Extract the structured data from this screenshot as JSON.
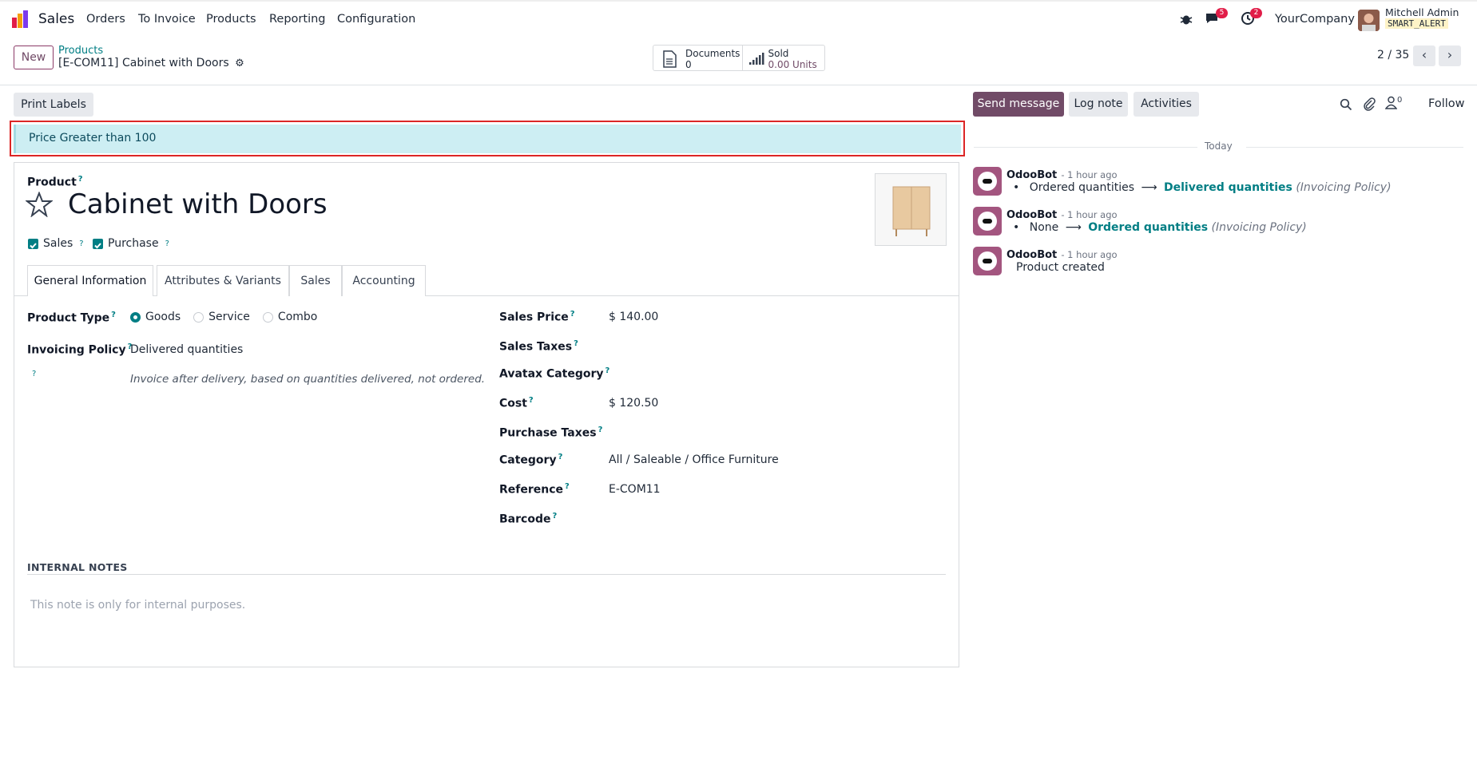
{
  "app": {
    "name": "Sales"
  },
  "menu": [
    "Orders",
    "To Invoice",
    "Products",
    "Reporting",
    "Configuration"
  ],
  "systray": {
    "messages_count": "5",
    "activities_count": "2",
    "company": "YourCompany",
    "user_name": "Mitchell Admin",
    "user_db": "SMART_ALERT"
  },
  "control": {
    "new_label": "New",
    "breadcrumb_parent": "Products",
    "breadcrumb_current": "[E-COM11] Cabinet with Doors",
    "pager": "2 / 35",
    "smart_buttons": [
      {
        "label": "Documents",
        "value": "0"
      },
      {
        "label": "Sold",
        "value": "0.00 Units"
      }
    ]
  },
  "form": {
    "print_labels": "Print Labels",
    "alert": "Price Greater than 100",
    "product_label": "Product",
    "product_name": "Cabinet with Doors",
    "sales_cb": "Sales",
    "purchase_cb": "Purchase",
    "tabs": [
      "General Information",
      "Attributes & Variants",
      "Sales",
      "Accounting"
    ],
    "product_type_label": "Product Type",
    "product_type_options": [
      "Goods",
      "Service",
      "Combo"
    ],
    "invoicing_policy_label": "Invoicing Policy",
    "invoicing_policy_value": "Delivered quantities",
    "invoicing_help": "Invoice after delivery, based on quantities delivered, not ordered.",
    "right_fields": [
      {
        "label": "Sales Price",
        "value": "$ 140.00"
      },
      {
        "label": "Sales Taxes",
        "value": ""
      },
      {
        "label": "Avatax Category",
        "value": ""
      },
      {
        "label": "Cost",
        "value": "$ 120.50"
      },
      {
        "label": "Purchase Taxes",
        "value": ""
      },
      {
        "label": "Category",
        "value": "All / Saleable / Office Furniture"
      },
      {
        "label": "Reference",
        "value": "E-COM11"
      },
      {
        "label": "Barcode",
        "value": ""
      }
    ],
    "internal_notes_header": "INTERNAL NOTES",
    "internal_notes_placeholder": "This note is only for internal purposes."
  },
  "chatter": {
    "send_message": "Send message",
    "log_note": "Log note",
    "activities": "Activities",
    "follow": "Follow",
    "followers_count": "0",
    "today": "Today",
    "messages": [
      {
        "author": "OdooBot",
        "time": "- 1 hour ago",
        "old": "Ordered quantities",
        "new": "Delivered quantities",
        "field": "(Invoicing Policy)"
      },
      {
        "author": "OdooBot",
        "time": "- 1 hour ago",
        "old": "None",
        "new": "Ordered quantities",
        "field": "(Invoicing Policy)"
      },
      {
        "author": "OdooBot",
        "time": "- 1 hour ago",
        "body": "Product created"
      }
    ]
  },
  "colors": {
    "brand": "#714B67",
    "teal": "#017e84",
    "alert_bg": "#cdeef3",
    "alert_border": "#dc2626"
  }
}
